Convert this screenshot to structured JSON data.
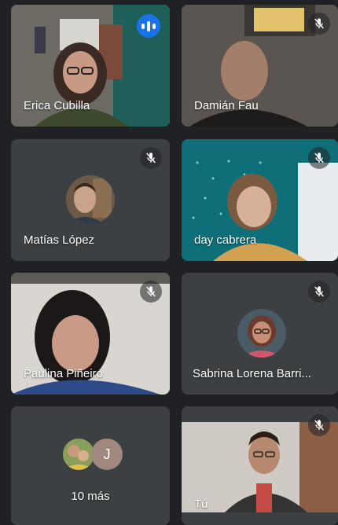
{
  "participants": [
    {
      "name": "Erica Cubilla",
      "speaking": true
    },
    {
      "name": "Damián Fau",
      "muted": true
    },
    {
      "name": "Matías López",
      "muted": true
    },
    {
      "name": "day cabrera",
      "muted": true
    },
    {
      "name": "Paulina Piñeiro",
      "muted": true
    },
    {
      "name": "Sabrina Lorena Barri..."
    },
    {
      "name": "Tú",
      "muted": true
    }
  ],
  "more": {
    "count_label": "10 más",
    "avatar_letter": "J"
  },
  "colors": {
    "background": "#202124",
    "tile": "#3c4043",
    "accent": "#1a73e8",
    "highlight": "#8ab4f8"
  }
}
